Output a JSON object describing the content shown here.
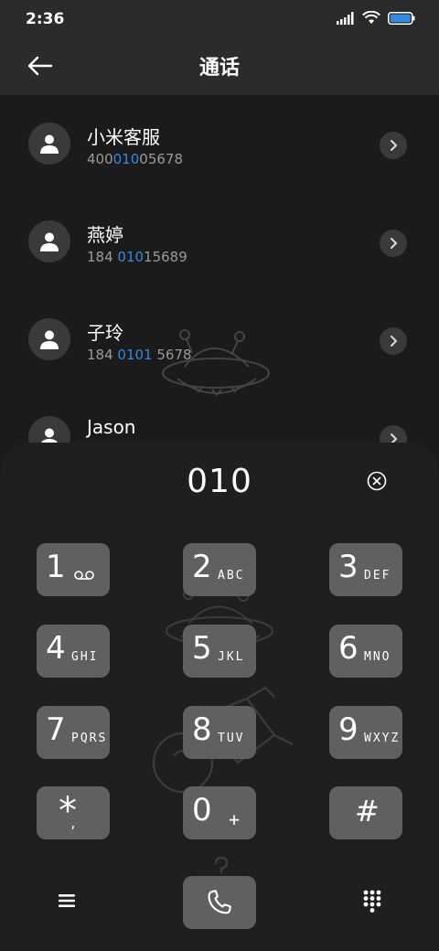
{
  "status_bar": {
    "time": "2:36"
  },
  "header": {
    "title": "通话"
  },
  "contacts": [
    {
      "name": "小米客服",
      "number_parts": [
        "400",
        "010",
        "05678"
      ]
    },
    {
      "name": "燕婷",
      "number_parts": [
        "184 ",
        "010",
        "15689"
      ]
    },
    {
      "name": "子玲",
      "number_parts": [
        "184 ",
        "0101",
        " 5678"
      ]
    },
    {
      "name": "Jason",
      "number_parts": [
        "",
        "",
        ""
      ]
    }
  ],
  "dialer": {
    "input_number": "010",
    "keys": [
      {
        "digit": "1",
        "letters": ""
      },
      {
        "digit": "2",
        "letters": "ABC"
      },
      {
        "digit": "3",
        "letters": "DEF"
      },
      {
        "digit": "4",
        "letters": "GHI"
      },
      {
        "digit": "5",
        "letters": "JKL"
      },
      {
        "digit": "6",
        "letters": "MNO"
      },
      {
        "digit": "7",
        "letters": "PQRS"
      },
      {
        "digit": "8",
        "letters": "TUV"
      },
      {
        "digit": "9",
        "letters": "WXYZ"
      },
      {
        "digit": "*",
        "letters": ","
      },
      {
        "digit": "0",
        "letters": "+"
      },
      {
        "digit": "#",
        "letters": ""
      }
    ]
  },
  "icons": {
    "back": "back-arrow-icon",
    "clear": "clear-circle-x-icon",
    "menu": "hamburger-menu-icon",
    "call": "phone-handset-icon",
    "keypad": "dialpad-icon",
    "voicemail": "voicemail-icon"
  },
  "colors": {
    "accent": "#2e8be6",
    "key_bg": "#606060",
    "panel_bg": "#1f1f1f"
  }
}
